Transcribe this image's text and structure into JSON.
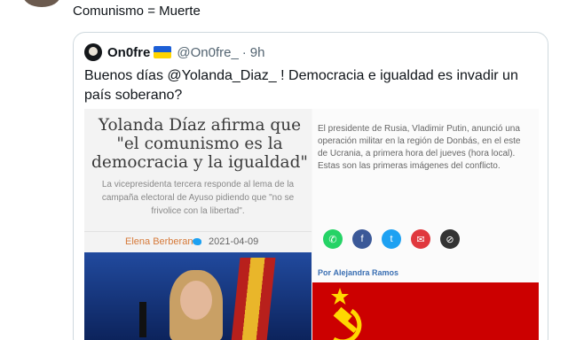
{
  "reply": {
    "text": "Comunismo = Muerte"
  },
  "quoted_tweet": {
    "display_name": "On0fre",
    "handle": "@On0fre_",
    "time": "9h",
    "text": "Buenos días @Yolanda_Diaz_ ! Democracia e igualdad es invadir un país soberano?"
  },
  "media_left": {
    "headline": "Yolanda Díaz afirma que \"el comunismo es la democracia y la igualdad\"",
    "subhead": "La vicepresidenta tercera responde al lema de la campaña electoral de Ayuso pidiendo que \"no se frivolice con la libertad\".",
    "author": "Elena Berberana",
    "date": "2021-04-09"
  },
  "media_right": {
    "text": "El presidente de Rusia, Vladimir Putin, anunció una operación militar en la región de Donbás, en el este de Ucrania, a primera hora del jueves (hora local). Estas son las primeras imágenes del conflicto.",
    "por_label": "Por",
    "author": "Alejandra Ramos"
  },
  "colors": {
    "accent": "#1da1f2",
    "text": "#0f1419",
    "muted": "#536471",
    "soviet_red": "#cc0000"
  },
  "icons": [
    "ukraine-flag-icon",
    "twitter-bird-icon",
    "whatsapp-icon",
    "facebook-icon",
    "twitter-icon",
    "email-icon",
    "link-icon",
    "hammer-sickle-icon"
  ]
}
